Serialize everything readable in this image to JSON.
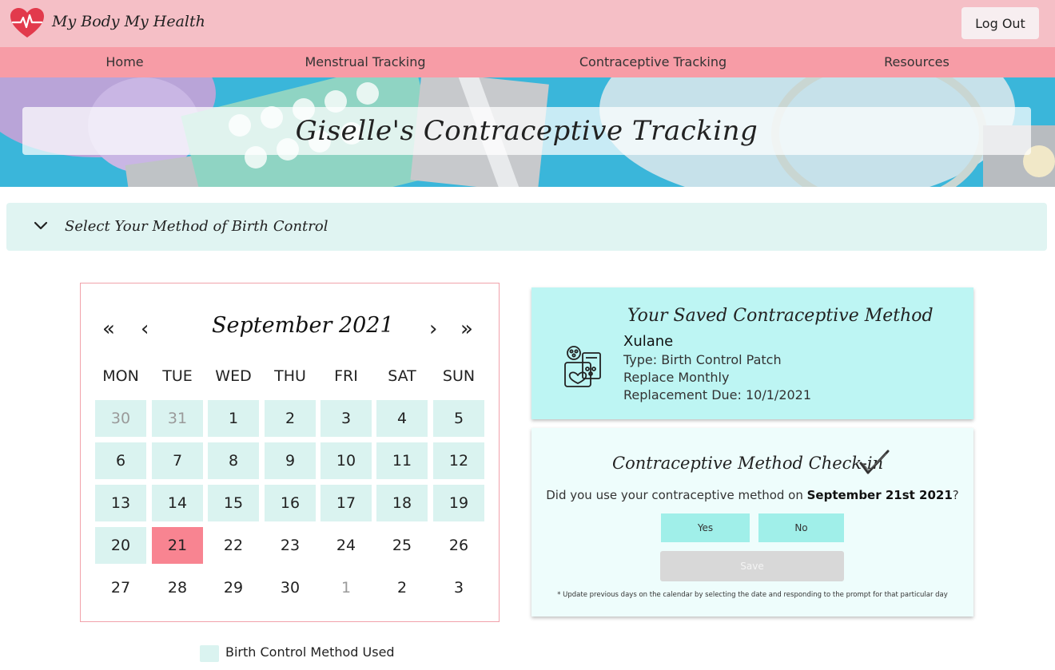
{
  "header": {
    "brand": "My Body My Health",
    "logout_label": "Log Out",
    "brand_color": "#e23a4c"
  },
  "nav": {
    "items": [
      {
        "label": "Home"
      },
      {
        "label": "Menstrual Tracking"
      },
      {
        "label": "Contraceptive Tracking"
      },
      {
        "label": "Resources"
      }
    ]
  },
  "hero": {
    "title": "Giselle's Contraceptive Tracking"
  },
  "method_selector": {
    "label": "Select Your Method of Birth Control",
    "state": "collapsed"
  },
  "calendar": {
    "month_label": "September 2021",
    "prev_year_glyph": "«",
    "prev_month_glyph": "‹",
    "next_month_glyph": "›",
    "next_year_glyph": "»",
    "weekdays": [
      "MON",
      "TUE",
      "WED",
      "THU",
      "FRI",
      "SAT",
      "SUN"
    ],
    "weeks": [
      [
        {
          "d": "30",
          "s": "used-other"
        },
        {
          "d": "31",
          "s": "used-other"
        },
        {
          "d": "1",
          "s": "used"
        },
        {
          "d": "2",
          "s": "used"
        },
        {
          "d": "3",
          "s": "used"
        },
        {
          "d": "4",
          "s": "used"
        },
        {
          "d": "5",
          "s": "used"
        }
      ],
      [
        {
          "d": "6",
          "s": "used"
        },
        {
          "d": "7",
          "s": "used"
        },
        {
          "d": "8",
          "s": "used"
        },
        {
          "d": "9",
          "s": "used"
        },
        {
          "d": "10",
          "s": "used"
        },
        {
          "d": "11",
          "s": "used"
        },
        {
          "d": "12",
          "s": "used"
        }
      ],
      [
        {
          "d": "13",
          "s": "used"
        },
        {
          "d": "14",
          "s": "used"
        },
        {
          "d": "15",
          "s": "used"
        },
        {
          "d": "16",
          "s": "used"
        },
        {
          "d": "17",
          "s": "used"
        },
        {
          "d": "18",
          "s": "used"
        },
        {
          "d": "19",
          "s": "used"
        }
      ],
      [
        {
          "d": "20",
          "s": "used"
        },
        {
          "d": "21",
          "s": "selected"
        },
        {
          "d": "22",
          "s": "plain"
        },
        {
          "d": "23",
          "s": "plain"
        },
        {
          "d": "24",
          "s": "plain"
        },
        {
          "d": "25",
          "s": "plain"
        },
        {
          "d": "26",
          "s": "plain"
        }
      ],
      [
        {
          "d": "27",
          "s": "plain"
        },
        {
          "d": "28",
          "s": "plain"
        },
        {
          "d": "29",
          "s": "plain"
        },
        {
          "d": "30",
          "s": "plain"
        },
        {
          "d": "1",
          "s": "other"
        },
        {
          "d": "2",
          "s": "plain"
        },
        {
          "d": "3",
          "s": "plain"
        }
      ]
    ],
    "used_color": "#daf3f0",
    "selected_color": "#f88491",
    "legend_label": "Birth Control Method Used"
  },
  "saved_method": {
    "title": "Your Saved Contraceptive Method",
    "name": "Xulane",
    "type": "Type: Birth Control Patch",
    "frequency": "Replace Monthly",
    "due": "Replacement Due: 10/1/2021"
  },
  "checkin": {
    "title": "Contraceptive Method Check-in",
    "question_prefix": "Did you use your contraceptive method on ",
    "question_date": "September 21st 2021",
    "question_suffix": "?",
    "yes_label": "Yes",
    "no_label": "No",
    "save_label": "Save",
    "footnote": "* Update previous days on the calendar by selecting the date and responding to the prompt for that particular day"
  }
}
